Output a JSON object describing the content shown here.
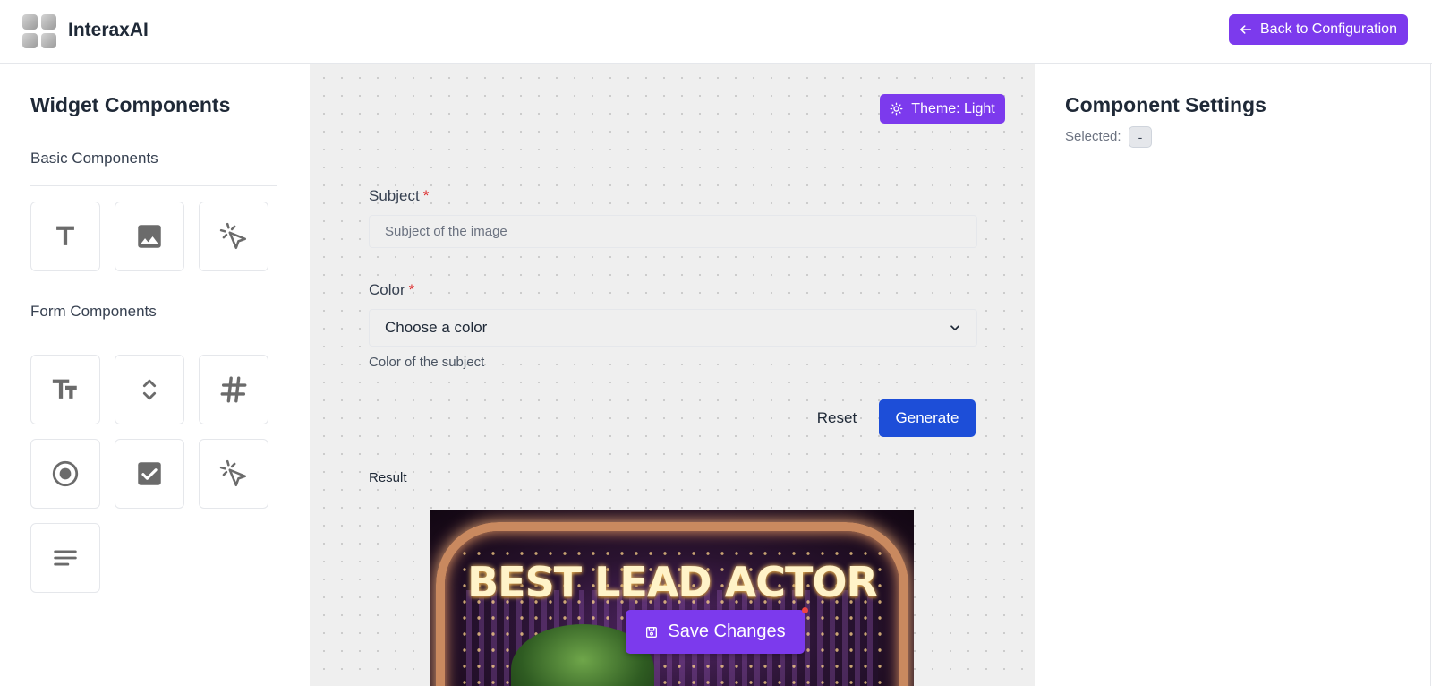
{
  "header": {
    "brand": "InteraxAI",
    "back_button": "Back to Configuration"
  },
  "left_panel": {
    "title": "Widget Components",
    "basic_section": "Basic Components",
    "basic_items": [
      "text-icon",
      "image-icon",
      "click-icon"
    ],
    "form_section": "Form Components",
    "form_items": [
      "text-size-icon",
      "unfold-icon",
      "hashtag-icon",
      "radio-icon",
      "checkbox-icon",
      "click-icon",
      "textarea-icon"
    ]
  },
  "canvas": {
    "theme_button": "Theme: Light",
    "subject_label": "Subject",
    "subject_required": "*",
    "subject_placeholder": "Subject of the image",
    "color_label": "Color",
    "color_required": "*",
    "color_select": "Choose a color",
    "color_help": "Color of the subject",
    "reset_button": "Reset",
    "generate_button": "Generate",
    "result_label": "Result",
    "result_image_text": "BEST LEAD ACTOR",
    "save_button": "Save Changes"
  },
  "right_panel": {
    "title": "Component Settings",
    "selected_label": "Selected:",
    "selected_value": "-"
  },
  "colors": {
    "accent_purple": "#7c3aed",
    "primary_blue": "#1d4ed8",
    "required_red": "#dc2626"
  }
}
